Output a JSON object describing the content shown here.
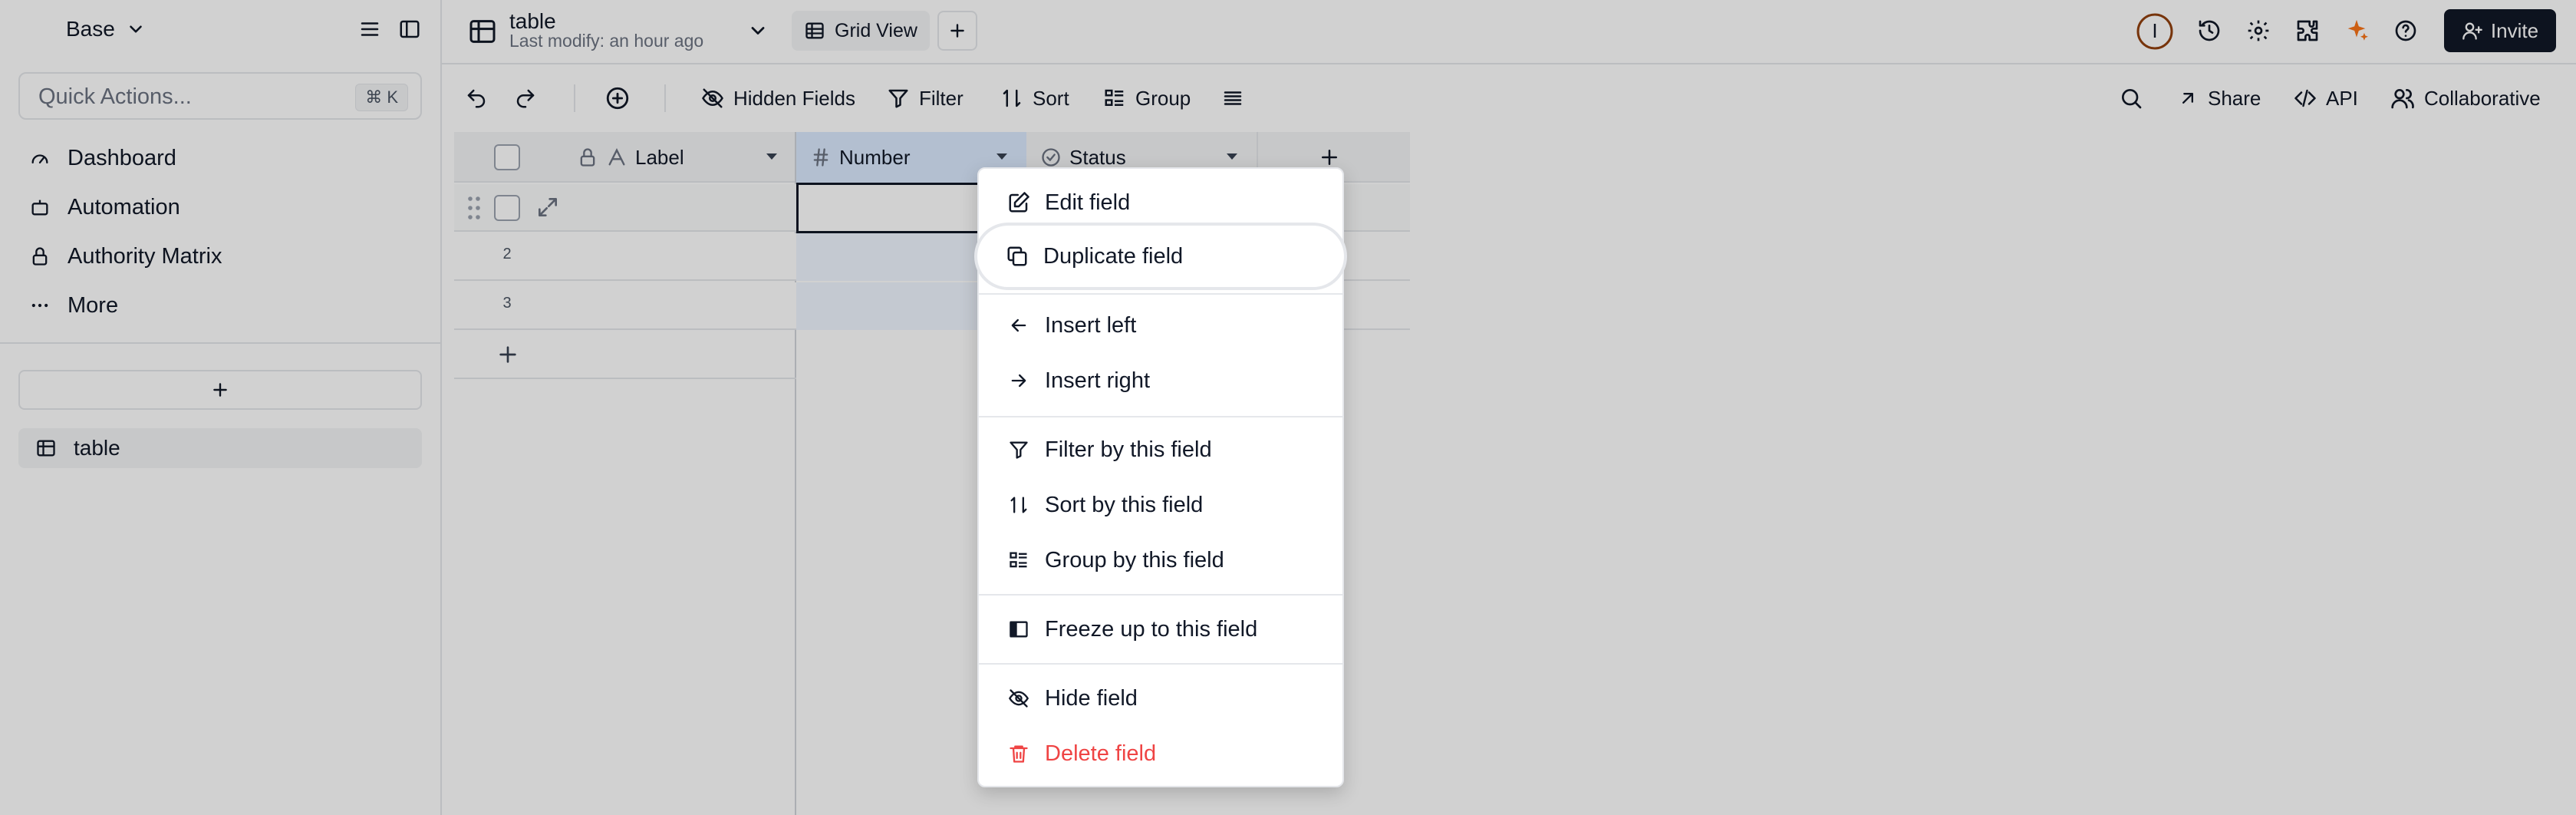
{
  "sidebar": {
    "base_label": "Base",
    "quick_actions": {
      "placeholder": "Quick Actions...",
      "shortcut": "⌘ K"
    },
    "nav": [
      {
        "label": "Dashboard",
        "icon": "dashboard-icon"
      },
      {
        "label": "Automation",
        "icon": "robot-icon"
      },
      {
        "label": "Authority Matrix",
        "icon": "lock-icon"
      },
      {
        "label": "More",
        "icon": "more-dots-icon"
      }
    ],
    "tables": [
      {
        "label": "table",
        "icon": "table-icon"
      }
    ]
  },
  "header": {
    "table_name": "table",
    "last_modify": "Last modify: an hour ago",
    "view_name": "Grid View",
    "avatar_initial": "I",
    "invite_label": "Invite"
  },
  "toolbar": {
    "hidden_fields": "Hidden Fields",
    "filter": "Filter",
    "sort": "Sort",
    "group": "Group",
    "share": "Share",
    "api": "API",
    "collaborative": "Collaborative"
  },
  "grid": {
    "columns": [
      {
        "label": "Label",
        "icon": "text-field-icon"
      },
      {
        "label": "Number",
        "icon": "hash-icon"
      },
      {
        "label": "Status",
        "icon": "checkcircle-icon"
      }
    ],
    "rows": [
      {
        "num": ""
      },
      {
        "num": "2"
      },
      {
        "num": "3"
      }
    ]
  },
  "context_menu": {
    "items": [
      {
        "label": "Edit field",
        "icon": "edit-icon"
      },
      {
        "label": "Duplicate field",
        "icon": "copy-icon"
      },
      {
        "label": "Insert left",
        "icon": "arrow-left-icon"
      },
      {
        "label": "Insert right",
        "icon": "arrow-right-icon"
      },
      {
        "label": "Filter by this field",
        "icon": "filter-icon"
      },
      {
        "label": "Sort by this field",
        "icon": "sort-icon"
      },
      {
        "label": "Group by this field",
        "icon": "group-icon"
      },
      {
        "label": "Freeze up to this field",
        "icon": "freeze-icon"
      },
      {
        "label": "Hide field",
        "icon": "eye-off-icon"
      },
      {
        "label": "Delete field",
        "icon": "trash-icon"
      }
    ],
    "highlighted_index": 1
  },
  "colors": {
    "accent_orange": "#f97316",
    "danger": "#ef4444",
    "invite_bg": "#111827"
  }
}
